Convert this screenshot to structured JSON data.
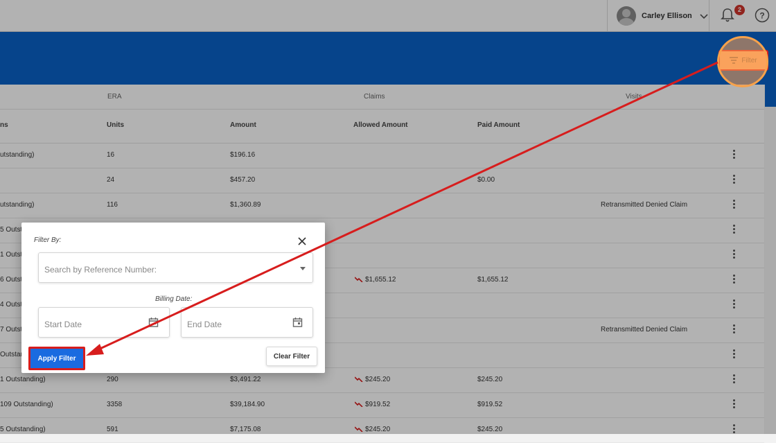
{
  "header": {
    "user_name": "Carley Ellison",
    "notification_count": "2"
  },
  "toolbar": {
    "filter_label": "Filter"
  },
  "table": {
    "groups": [
      "ERA",
      "Claims",
      "Visits"
    ],
    "columns": [
      "ns",
      "Units",
      "Amount",
      "Allowed Amount",
      "Paid Amount"
    ],
    "rows": [
      {
        "status": "utstanding)",
        "units": "16",
        "amount": "$196.16",
        "allowed": "",
        "paid": "",
        "note": ""
      },
      {
        "status": "",
        "units": "24",
        "amount": "$457.20",
        "allowed": "",
        "paid": "$0.00",
        "note": ""
      },
      {
        "status": "utstanding)",
        "units": "116",
        "amount": "$1,360.89",
        "allowed": "",
        "paid": "",
        "note": "Retransmitted Denied Claim"
      },
      {
        "status": "5 Outst",
        "units": "",
        "amount": "",
        "allowed": "",
        "paid": "",
        "note": ""
      },
      {
        "status": "1 Outst",
        "units": "",
        "amount": "",
        "allowed": "",
        "paid": "",
        "note": ""
      },
      {
        "status": "6 Outst",
        "units": "",
        "amount": "",
        "allowed": "$1,655.12",
        "paid": "$1,655.12",
        "note": ""
      },
      {
        "status": "4 Outst",
        "units": "",
        "amount": "",
        "allowed": "",
        "paid": "",
        "note": ""
      },
      {
        "status": "7 Outst",
        "units": "",
        "amount": "",
        "allowed": "",
        "paid": "",
        "note": "Retransmitted Denied Claim"
      },
      {
        "status": "Outstan",
        "units": "",
        "amount": "",
        "allowed": "",
        "paid": "",
        "note": ""
      },
      {
        "status": "1 Outstanding)",
        "units": "290",
        "amount": "$3,491.22",
        "allowed": "$245.20",
        "paid": "$245.20",
        "note": ""
      },
      {
        "status": "109 Outstanding)",
        "units": "3358",
        "amount": "$39,184.90",
        "allowed": "$919.52",
        "paid": "$919.52",
        "note": ""
      },
      {
        "status": "5 Outstanding)",
        "units": "591",
        "amount": "$7,175.08",
        "allowed": "$245.20",
        "paid": "$245.20",
        "note": ""
      }
    ]
  },
  "filter_modal": {
    "title": "Filter By:",
    "reference_placeholder": "Search by Reference Number:",
    "billing_date_label": "Billing Date:",
    "start_placeholder": "Start Date",
    "end_placeholder": "End Date",
    "apply_label": "Apply Filter",
    "clear_label": "Clear Filter"
  },
  "colors": {
    "brand_blue": "#0a62c8",
    "apply_blue": "#1a6be0",
    "annotation_red": "#d71d1d",
    "highlight_orange": "#f7a24b",
    "badge_red": "#d0342c"
  },
  "icons": [
    "chevron-down-icon",
    "bell-icon",
    "help-icon",
    "filter-icon",
    "close-icon",
    "calendar-icon",
    "trend-down-icon",
    "more-vertical-icon"
  ]
}
